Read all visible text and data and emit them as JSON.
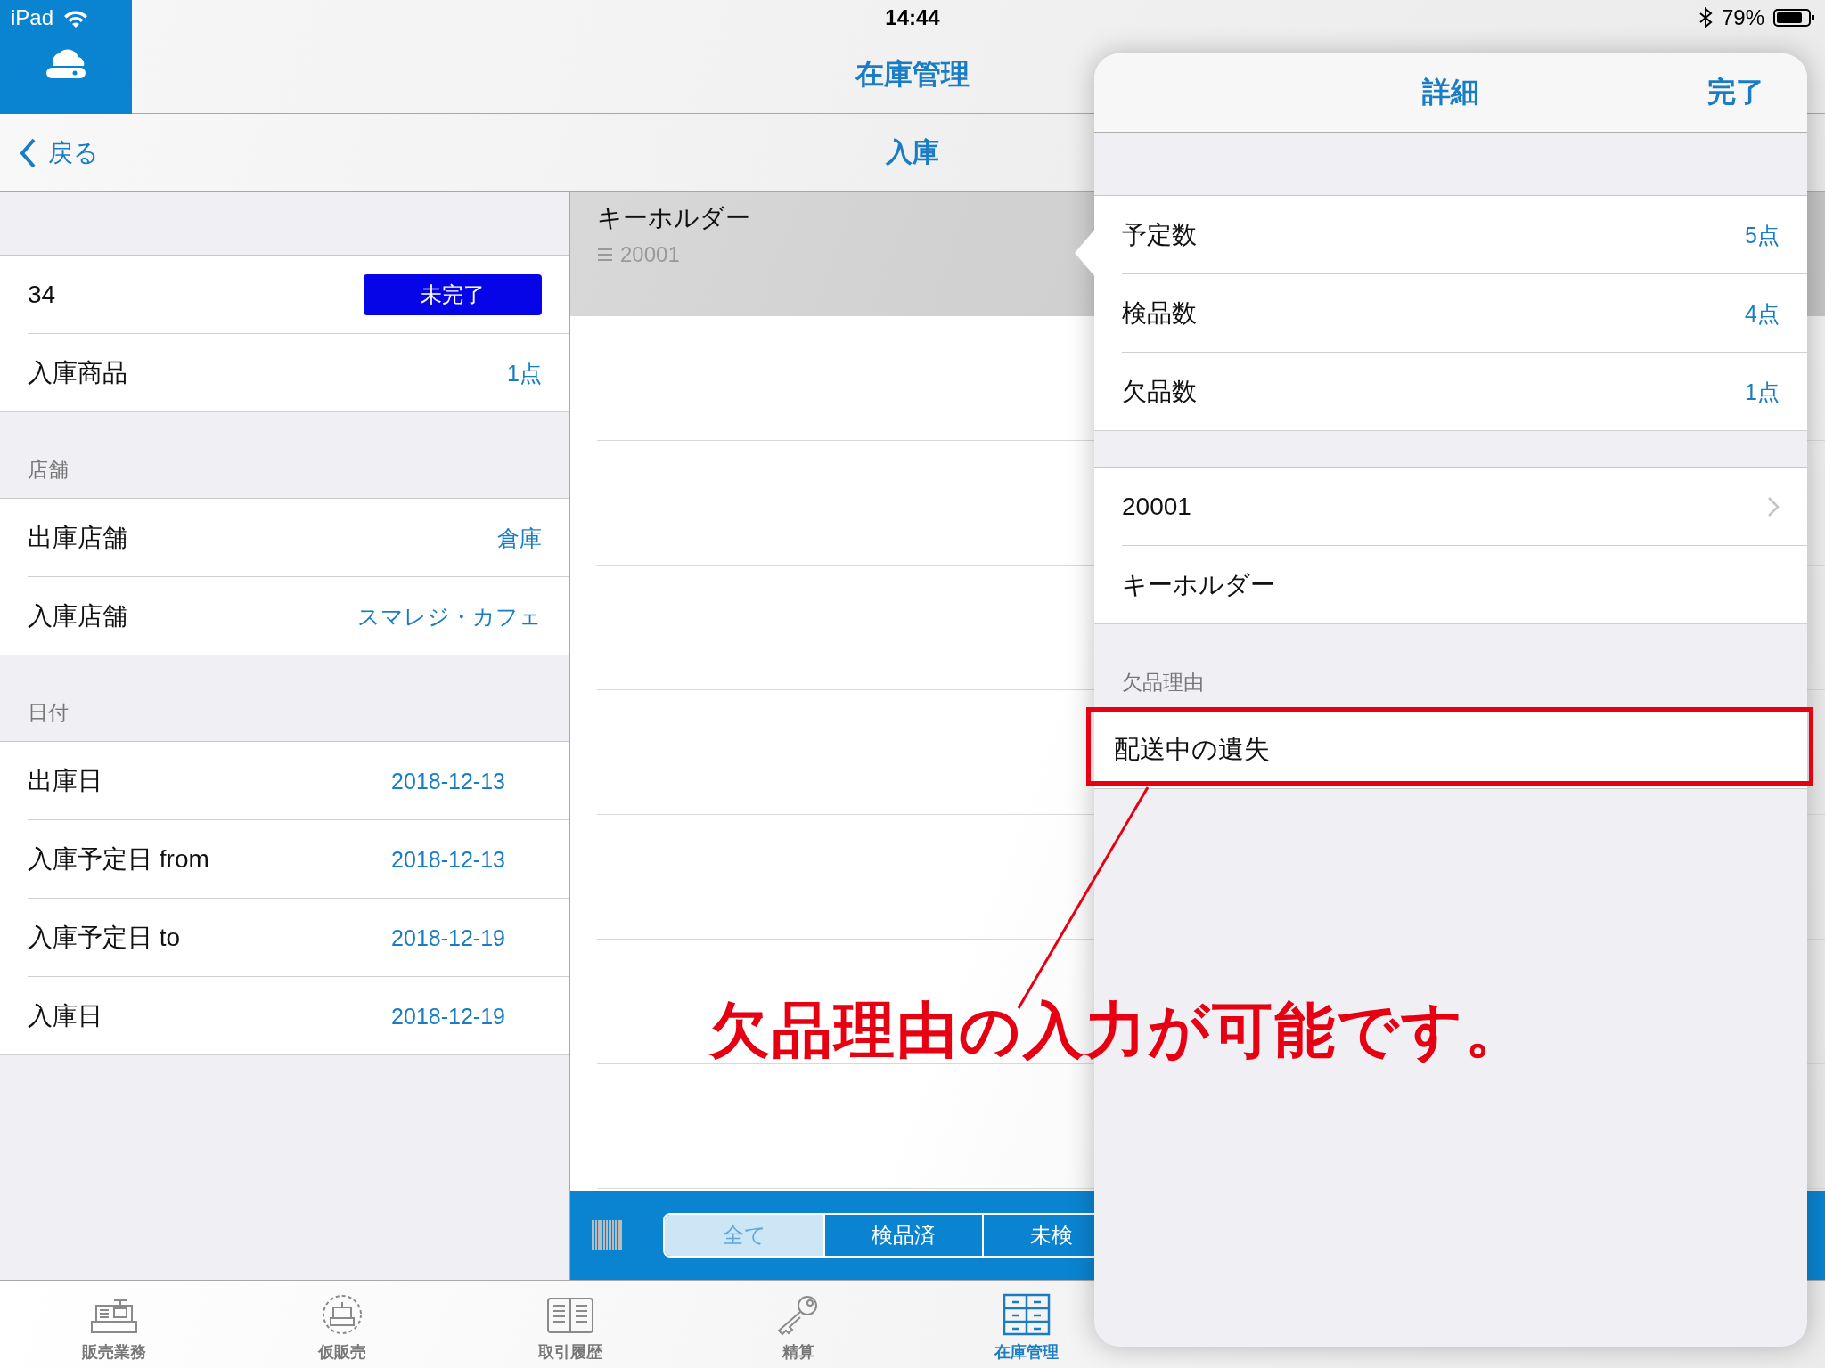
{
  "status_bar": {
    "device": "iPad",
    "time": "14:44",
    "battery": "79%"
  },
  "app_nav": {
    "title": "在庫管理"
  },
  "sub_nav": {
    "back": "戻る",
    "title": "入庫"
  },
  "summary": {
    "number": "34",
    "status": "未完了",
    "items": [
      {
        "label": "入庫商品",
        "value": "1点"
      }
    ]
  },
  "sections": [
    {
      "header": "店舗",
      "rows": [
        {
          "label": "出庫店舗",
          "value": "倉庫"
        },
        {
          "label": "入庫店舗",
          "value": "スマレジ・カフェ"
        }
      ]
    },
    {
      "header": "日付",
      "rows": [
        {
          "label": "出庫日",
          "value": "2018-12-13"
        },
        {
          "label": "入庫予定日 from",
          "value": "2018-12-13"
        },
        {
          "label": "入庫予定日 to",
          "value": "2018-12-19"
        },
        {
          "label": "入庫日",
          "value": "2018-12-19"
        }
      ]
    }
  ],
  "products": [
    {
      "name": "キーホルダー",
      "code": "20001",
      "selected": true
    }
  ],
  "filter": {
    "segments": [
      {
        "label": "全て",
        "selected": true
      },
      {
        "label": "検品済",
        "selected": false
      },
      {
        "label": "未検",
        "selected": false
      }
    ]
  },
  "detail": {
    "title": "詳細",
    "done": "完了",
    "counts": [
      {
        "label": "予定数",
        "value": "5点"
      },
      {
        "label": "検品数",
        "value": "4点"
      },
      {
        "label": "欠品数",
        "value": "1点"
      }
    ],
    "product": {
      "code": "20001",
      "name": "キーホルダー"
    },
    "reason": {
      "header": "欠品理由",
      "value": "配送中の遺失"
    }
  },
  "tab_bar": [
    {
      "label": "販売業務",
      "kind": "register",
      "selected": false
    },
    {
      "label": "仮販売",
      "kind": "draft",
      "selected": false
    },
    {
      "label": "取引履歴",
      "kind": "ledger",
      "selected": false
    },
    {
      "label": "精算",
      "kind": "key",
      "selected": false
    },
    {
      "label": "在庫管理",
      "kind": "cabinet",
      "selected": true
    }
  ],
  "annotation": {
    "text": "欠品理由の入力が可能です。"
  }
}
